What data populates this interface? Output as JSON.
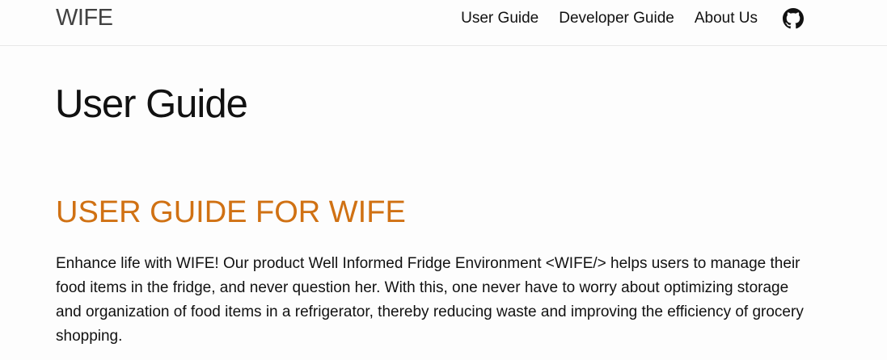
{
  "navbar": {
    "brand": "WIFE",
    "links": [
      {
        "label": "User Guide"
      },
      {
        "label": "Developer Guide"
      },
      {
        "label": "About Us"
      }
    ],
    "github_icon": "github-icon"
  },
  "main": {
    "page_title": "User Guide",
    "section_heading": "USER GUIDE FOR WIFE",
    "intro": "Enhance life with WIFE! Our product Well Informed Fridge Environment <WIFE/> helps users to manage their food items in the fridge, and never question her. With this, one never have to worry about optimizing storage and organization of food items in a refrigerator, thereby reducing waste and improving the efficiency of grocery shopping."
  },
  "colors": {
    "accent": "#d07113",
    "text": "#111111",
    "brand": "#424242"
  }
}
